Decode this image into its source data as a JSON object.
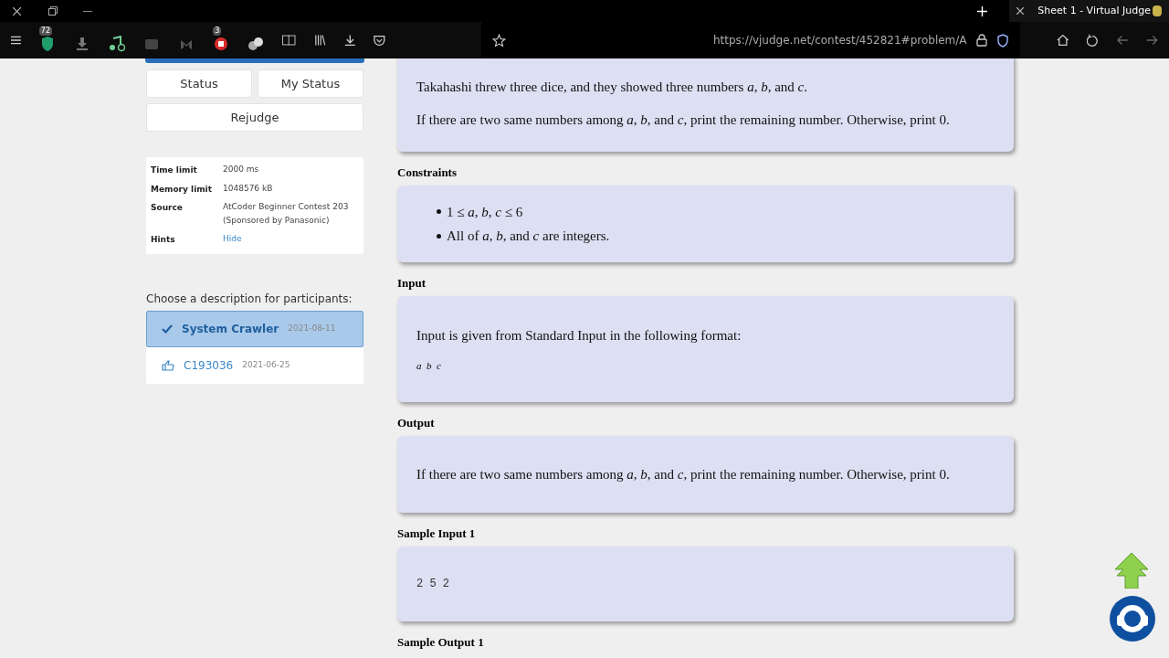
{
  "browser": {
    "tab_title": "Sheet 1 - Virtual Judge",
    "url": "https://vjudge.net/contest/452821#problem/A",
    "extension_badges": [
      {
        "kind": "shield",
        "badge": "72"
      },
      {
        "kind": "download"
      },
      {
        "kind": "music"
      },
      {
        "kind": "video"
      },
      {
        "kind": "malware"
      },
      {
        "kind": "record",
        "badge": "3"
      },
      {
        "kind": "balls"
      }
    ]
  },
  "sidebar": {
    "buttons": [
      {
        "label": "Status"
      },
      {
        "label": "My Status"
      }
    ],
    "rejudge": "Rejudge",
    "info": [
      {
        "label": "Time limit",
        "value": "2000 ms"
      },
      {
        "label": "Memory limit",
        "value": "1048576 kB"
      },
      {
        "label": "Source",
        "value": "AtCoder Beginner Contest 203  (Sponsored by Panasonic)"
      },
      {
        "label": "Hints",
        "value": "Hide",
        "link": true
      }
    ],
    "description_prompt": "Choose a description for participants:",
    "descriptions": [
      {
        "name": "System Crawler",
        "date": "2021-08-11",
        "selected": true
      },
      {
        "name": "C193036",
        "date": "2021-06-25",
        "selected": false
      }
    ]
  },
  "sections": [
    {
      "kind": "text",
      "paragraphs": [
        "Takahashi threw three dice, and they showed three numbers *a*, *b*, and *c*.",
        "If there are two same numbers among *a*, *b*, and *c*, print the remaining number. Otherwise, print 0."
      ]
    },
    {
      "kind": "list",
      "heading": "Constraints",
      "items": [
        "1 ≤ *a*, *b*, *c* ≤ 6",
        "All of *a*, *b*, and *c* are integers."
      ]
    },
    {
      "kind": "format",
      "heading": "Input",
      "paragraphs": [
        "Input is given from Standard Input in the following format:"
      ],
      "format": "*a*  *b*  *c*"
    },
    {
      "kind": "text",
      "heading": "Output",
      "paragraphs": [
        "If there are two same numbers among *a*, *b*, and *c*, print the remaining number. Otherwise, print 0."
      ]
    },
    {
      "kind": "code",
      "heading": "Sample Input 1",
      "code": "2 5 2"
    },
    {
      "kind": "text",
      "heading": "Sample Output 1"
    }
  ]
}
